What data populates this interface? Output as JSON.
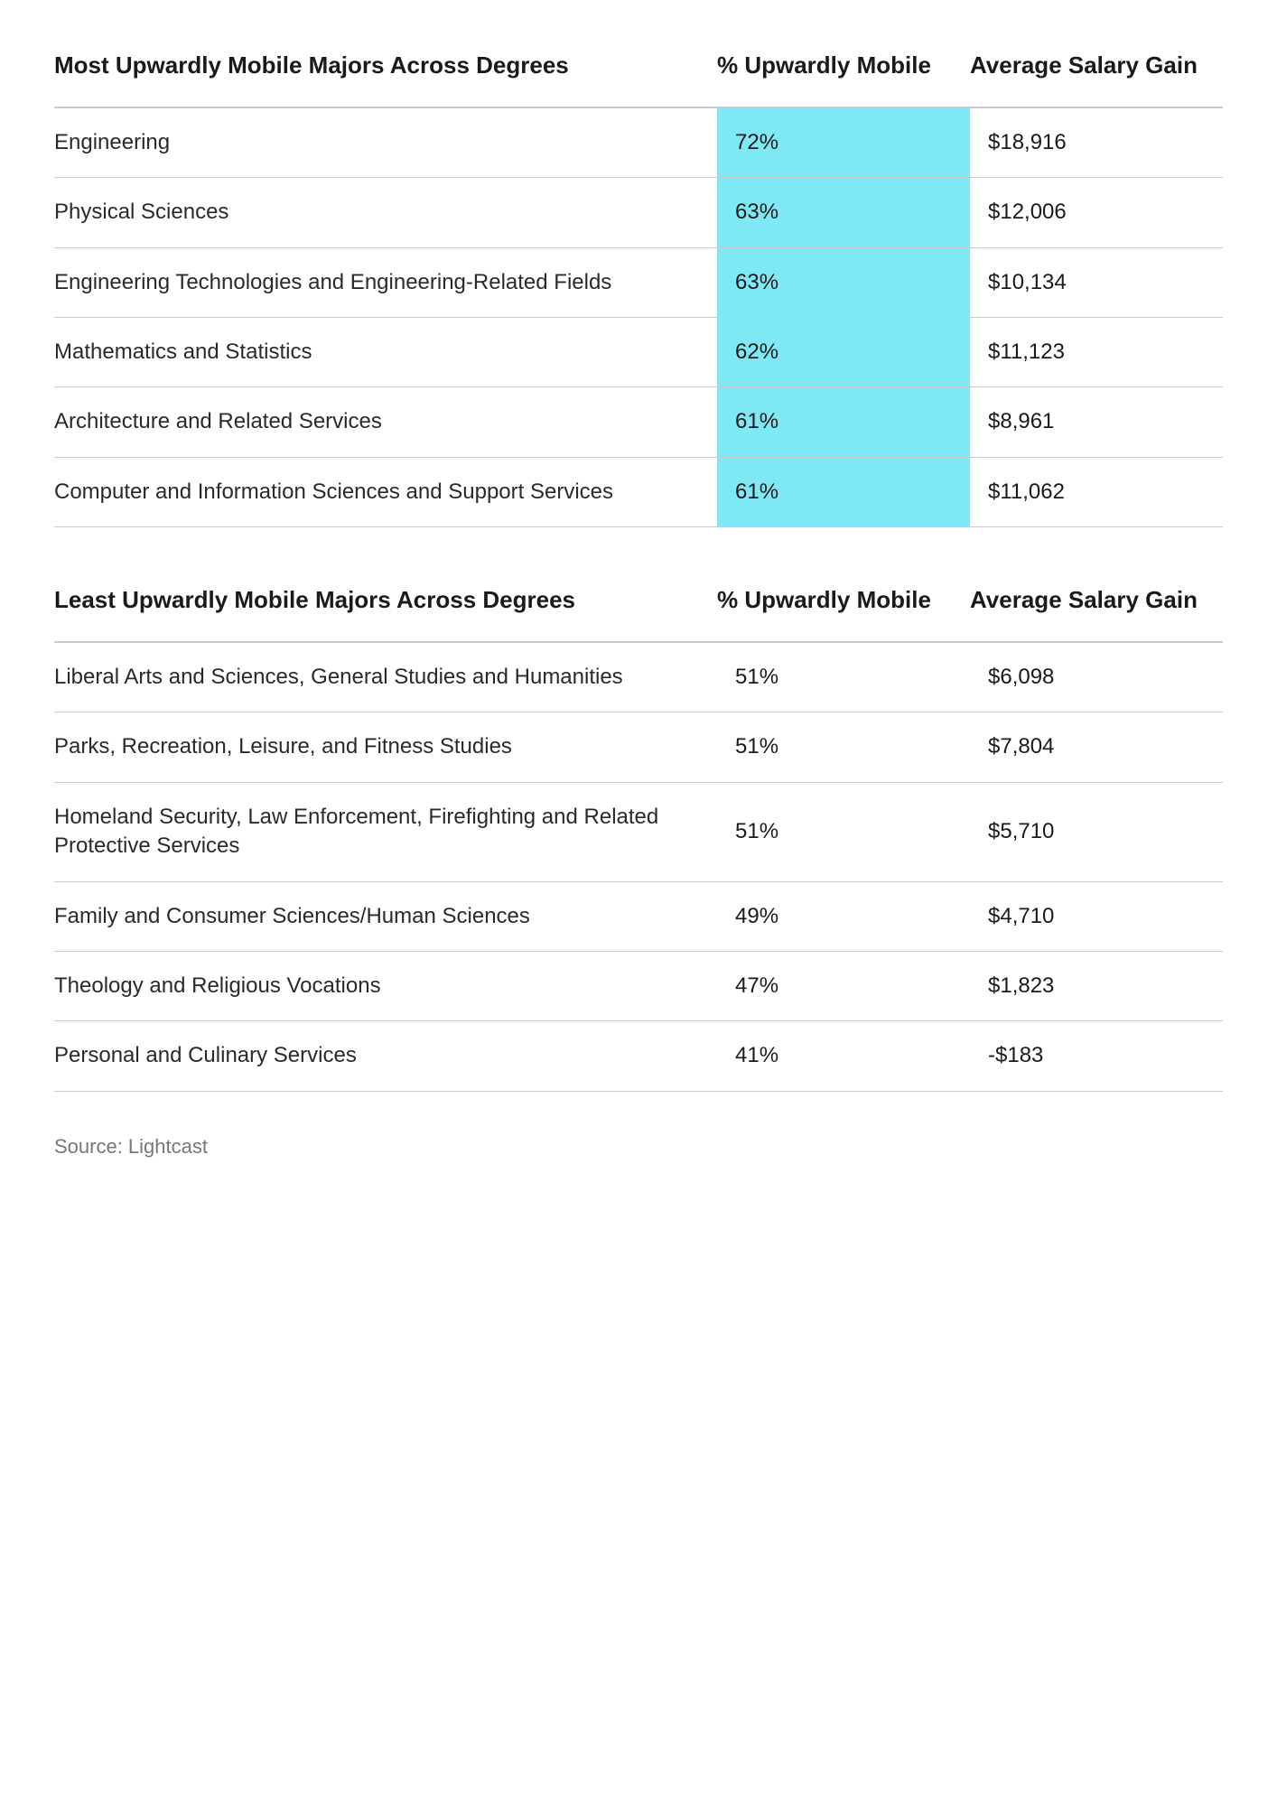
{
  "most_section": {
    "title": "Most Upwardly Mobile Majors Across Degrees",
    "col1_header": "Most Upwardly Mobile Majors Across Degrees",
    "col2_header": "% Upwardly Mobile",
    "col3_header": "Average Salary Gain",
    "rows": [
      {
        "major": "Engineering",
        "pct": "72%",
        "salary": "$18,916",
        "highlight": true
      },
      {
        "major": "Physical Sciences",
        "pct": "63%",
        "salary": "$12,006",
        "highlight": true
      },
      {
        "major": "Engineering Technologies and Engineering-Related Fields",
        "pct": "63%",
        "salary": "$10,134",
        "highlight": true
      },
      {
        "major": "Mathematics and Statistics",
        "pct": "62%",
        "salary": "$11,123",
        "highlight": true
      },
      {
        "major": "Architecture and Related Services",
        "pct": "61%",
        "salary": "$8,961",
        "highlight": true
      },
      {
        "major": "Computer and Information Sciences and Support Services",
        "pct": "61%",
        "salary": "$11,062",
        "highlight": true
      }
    ]
  },
  "least_section": {
    "title": "Least Upwardly Mobile Majors Across Degrees",
    "col1_header": "Least Upwardly Mobile Majors Across Degrees",
    "col2_header": "% Upwardly Mobile",
    "col3_header": "Average Salary Gain",
    "rows": [
      {
        "major": "Liberal Arts and Sciences, General Studies and Humanities",
        "pct": "51%",
        "salary": "$6,098",
        "highlight": false
      },
      {
        "major": "Parks, Recreation, Leisure, and Fitness Studies",
        "pct": "51%",
        "salary": "$7,804",
        "highlight": false
      },
      {
        "major": "Homeland Security, Law Enforcement, Firefighting and Related Protective Services",
        "pct": "51%",
        "salary": "$5,710",
        "highlight": false
      },
      {
        "major": "Family and Consumer Sciences/Human Sciences",
        "pct": "49%",
        "salary": "$4,710",
        "highlight": false
      },
      {
        "major": "Theology and Religious Vocations",
        "pct": "47%",
        "salary": "$1,823",
        "highlight": false
      },
      {
        "major": "Personal and Culinary Services",
        "pct": "41%",
        "salary": "-$183",
        "highlight": false
      }
    ]
  },
  "source": "Source: Lightcast"
}
